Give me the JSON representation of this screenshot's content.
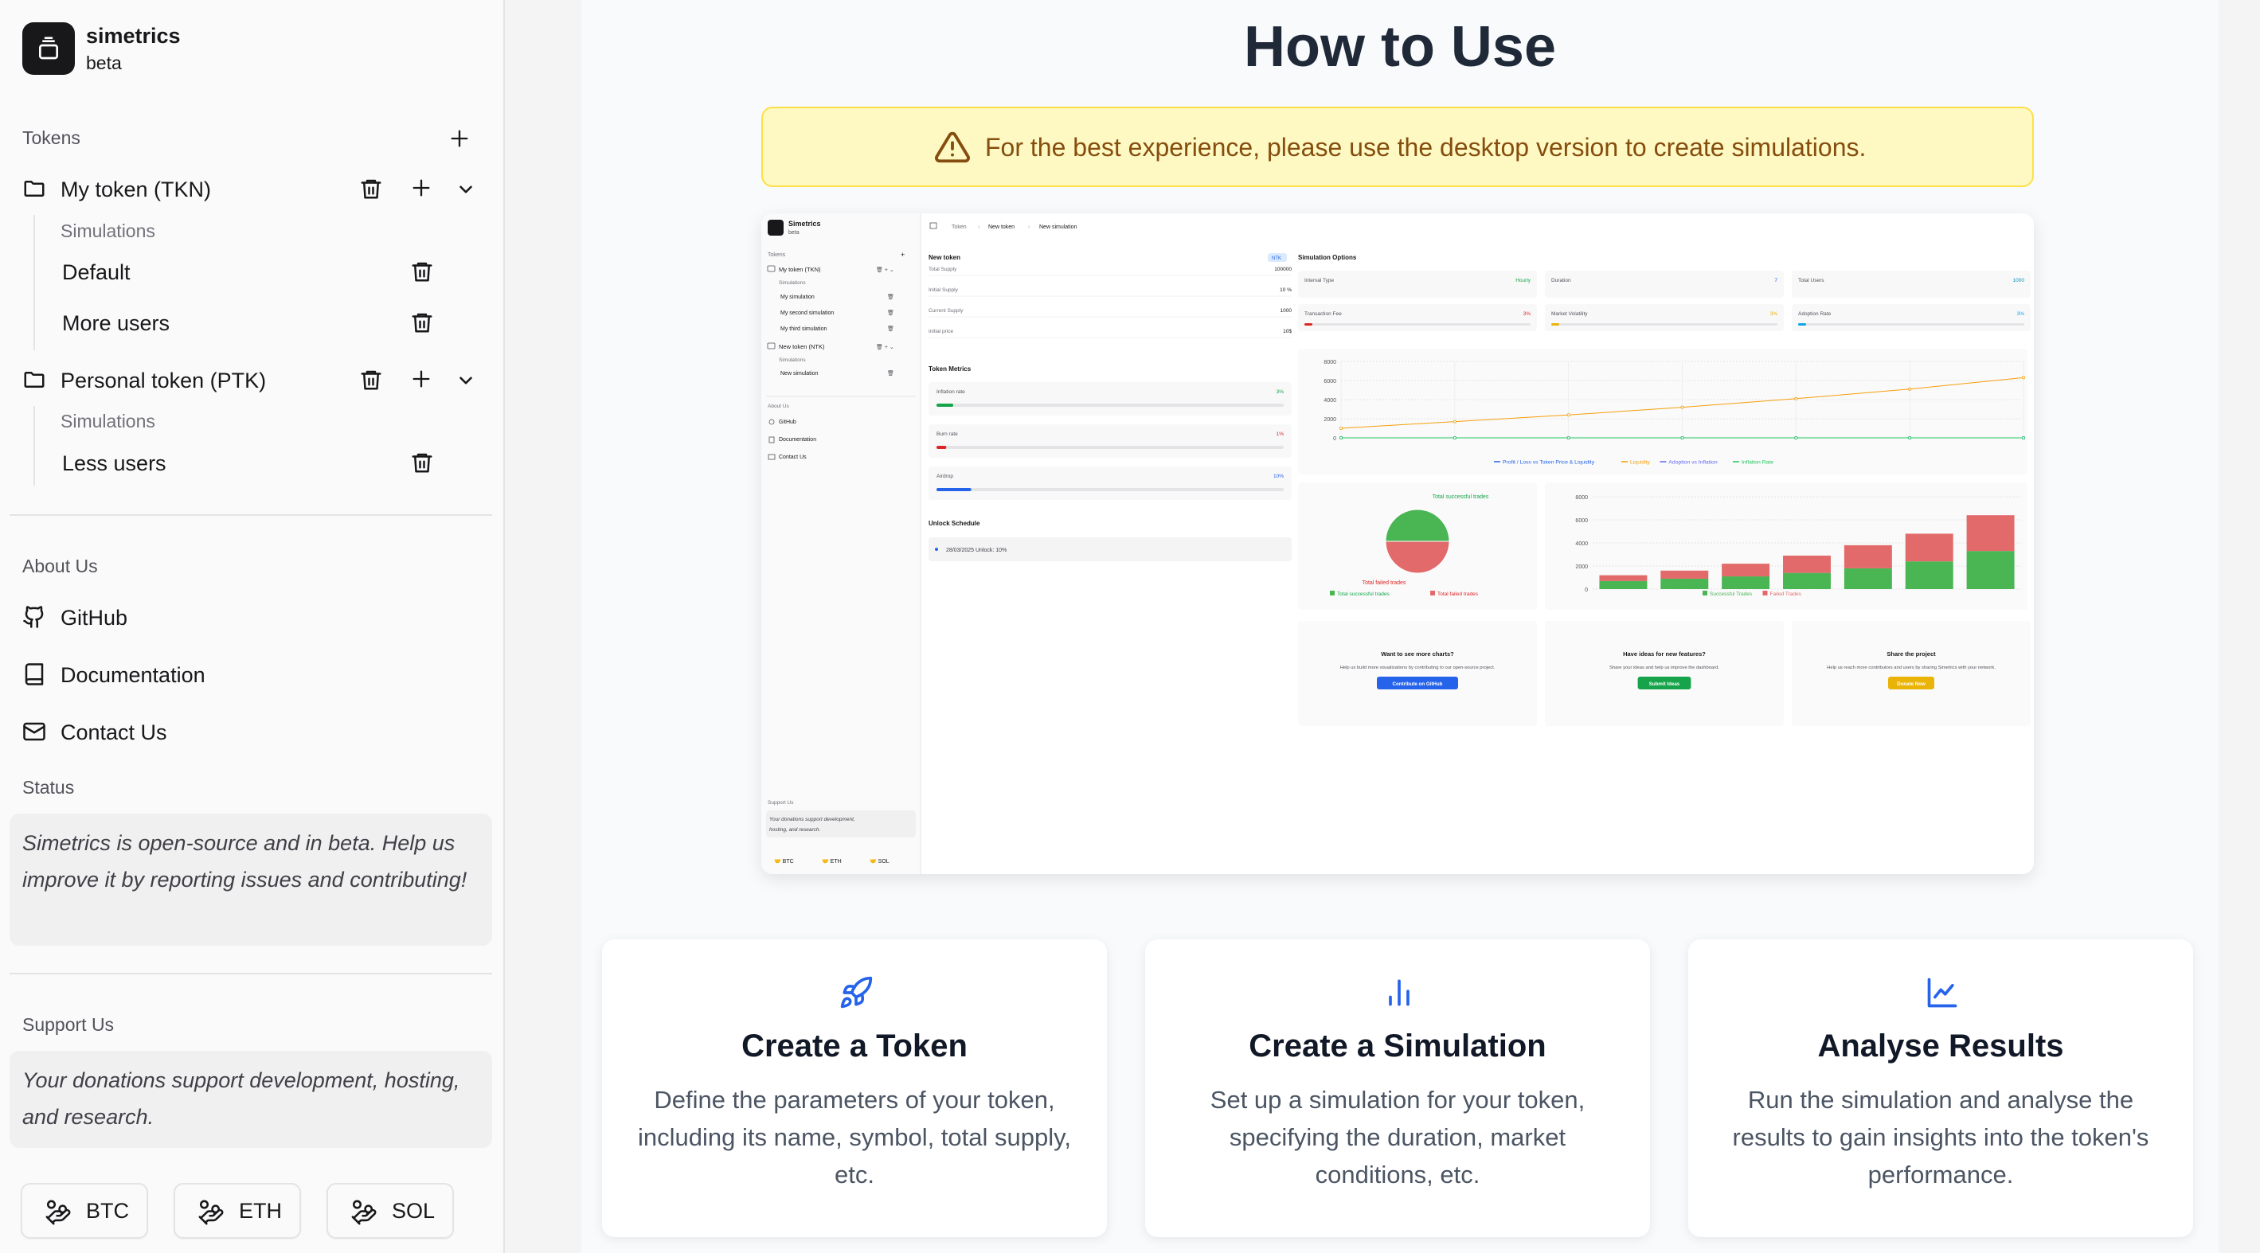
{
  "app": {
    "title": "simetrics",
    "subtitle": "beta"
  },
  "sidebar": {
    "tokens_label": "Tokens",
    "tokens": [
      {
        "name": "My token (TKN)",
        "simulations_label": "Simulations",
        "simulations": [
          "Default",
          "More users"
        ]
      },
      {
        "name": "Personal token (PTK)",
        "simulations_label": "Simulations",
        "simulations": [
          "Less users"
        ]
      }
    ],
    "about_label": "About Us",
    "links": [
      "GitHub",
      "Documentation",
      "Contact Us"
    ],
    "status_label": "Status",
    "status_text": "Simetrics is open-source and in beta. Help us improve it by reporting issues and contributing!",
    "support_label": "Support Us",
    "support_text": "Your donations support development, hosting, and research.",
    "crypto": [
      "BTC",
      "ETH",
      "SOL"
    ]
  },
  "main": {
    "title": "How to Use",
    "alert": "For the best experience, please use the desktop version to create simulations.",
    "preview": {
      "app_title": "Simetrics",
      "app_sub": "beta",
      "breadcrumb": [
        "Token",
        "New token",
        "New simulation"
      ],
      "sidebar": {
        "tokens_label": "Tokens",
        "token1": "My token (TKN)",
        "sims_label": "Simulations",
        "sims1": [
          "My simulation",
          "My second simulation",
          "My third simulation"
        ],
        "token2": "New token (NTK)",
        "sims2": [
          "New simulation"
        ],
        "about": "About Us",
        "links": [
          "GitHub",
          "Documentation",
          "Contact Us"
        ],
        "support": "Support Us",
        "support_text": "Your donations support development, hosting, and research.",
        "crypto": [
          "BTC",
          "ETH",
          "SOL"
        ]
      },
      "token": {
        "title": "New token",
        "badge": "NTK",
        "fields": [
          {
            "label": "Total Supply",
            "value": "100000"
          },
          {
            "label": "Initial Supply",
            "value": "10 %"
          },
          {
            "label": "Current Supply",
            "value": "1000"
          },
          {
            "label": "Initial price",
            "value": "10$"
          }
        ],
        "metrics_title": "Token Metrics",
        "metrics": [
          {
            "label": "Inflation rate",
            "value": "3%",
            "color": "#16a34a",
            "fill": 0.03
          },
          {
            "label": "Burn rate",
            "value": "1%",
            "color": "#dc2626",
            "fill": 0.01
          },
          {
            "label": "Airdrop",
            "value": "10%",
            "color": "#2563eb",
            "fill": 0.1
          }
        ],
        "unlock_title": "Unlock Schedule",
        "unlock_item": "28/03/2025   Unlock: 10%"
      },
      "sim": {
        "title": "Simulation Options",
        "options": [
          {
            "label": "Interval Type",
            "value": "Hourly",
            "color": "#16a34a"
          },
          {
            "label": "Duration",
            "value": "7",
            "color": "#2563eb"
          },
          {
            "label": "Total Users",
            "value": "1000",
            "color": "#0891b2"
          },
          {
            "label": "Transaction Fee",
            "value": "3%",
            "color": "#dc2626",
            "fill": 0.03
          },
          {
            "label": "Market Volatility",
            "value": "3%",
            "color": "#eab308",
            "fill": 0.03
          },
          {
            "label": "Adoption Rate",
            "value": "3%",
            "color": "#0ea5e9",
            "fill": 0.03
          }
        ]
      },
      "charts": {
        "line": {
          "type": "line",
          "ylim": [
            0,
            8000
          ],
          "yticks": [
            "8000",
            "6000",
            "4000",
            "2000",
            "0"
          ],
          "series": [
            {
              "name": "Profit / Loss vs Token Price & Liquidity",
              "color": "#2563eb",
              "values": [
                0,
                0,
                0,
                0,
                0,
                0,
                0
              ]
            },
            {
              "name": "Liquidity",
              "color": "#f59e0b",
              "values": [
                1000,
                1700,
                2400,
                3200,
                4100,
                5100,
                6300
              ]
            },
            {
              "name": "Adoption vs Inflation",
              "color": "#6366f1",
              "values": [
                0,
                0,
                0,
                0,
                0,
                0,
                0
              ]
            },
            {
              "name": "Inflation Rate",
              "color": "#22c55e",
              "values": [
                0,
                0,
                0,
                0,
                0,
                0,
                0
              ]
            }
          ]
        },
        "pie": {
          "type": "pie",
          "slices": [
            {
              "name": "Total successful trades",
              "value": 50,
              "color": "#4ab553"
            },
            {
              "name": "Total failed trades",
              "value": 50,
              "color": "#e26a6a"
            }
          ],
          "top_label": "Total successful trades",
          "bottom_label": "Total failed trades",
          "legend": [
            "Total successful trades",
            "Total failed trades"
          ]
        },
        "bar": {
          "type": "bar",
          "ylim": [
            0,
            8000
          ],
          "yticks": [
            "8000",
            "6000",
            "4000",
            "2000",
            "0"
          ],
          "series": [
            {
              "name": "Successful Trades",
              "color": "#4ab553",
              "values": [
                700,
                900,
                1100,
                1400,
                1800,
                2400,
                3300
              ]
            },
            {
              "name": "Failed Trades",
              "color": "#e26a6a",
              "values": [
                500,
                700,
                1100,
                1500,
                2000,
                2400,
                3100
              ]
            }
          ]
        }
      },
      "promos": [
        {
          "title": "Want to see more charts?",
          "text": "Help us build more visualizations by contributing to our open-source project.",
          "button": "Contribute on GitHub",
          "color": "#2563eb"
        },
        {
          "title": "Have ideas for new features?",
          "text": "Share your ideas and help us improve the dashboard.",
          "button": "Submit Ideas",
          "color": "#16a34a"
        },
        {
          "title": "Share the project",
          "text": "Help us reach more contributors and users by sharing Simetrics with your network.",
          "button": "Donate Now",
          "color": "#eab308"
        }
      ]
    },
    "cards": [
      {
        "icon": "rocket-icon",
        "title": "Create a Token",
        "text": "Define the parameters of your token, including its name, symbol, total supply, etc."
      },
      {
        "icon": "bar-chart-icon",
        "title": "Create a Simulation",
        "text": "Set up a simulation for your token, specifying the duration, market conditions, etc."
      },
      {
        "icon": "line-chart-icon",
        "title": "Analyse Results",
        "text": "Run the simulation and analyse the results to gain insights into the token's performance."
      }
    ],
    "accent": "#2563eb"
  }
}
